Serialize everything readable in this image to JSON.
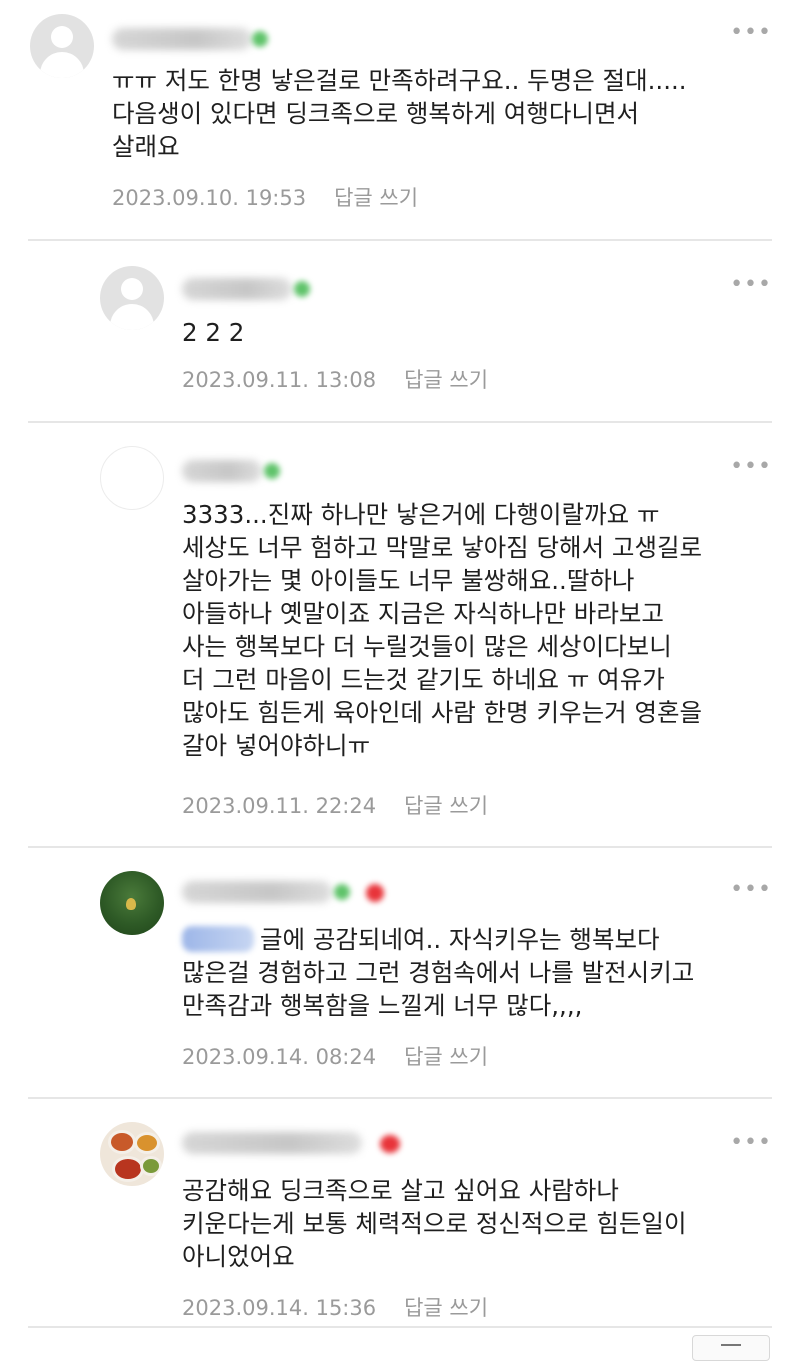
{
  "comments": [
    {
      "text": "ㅠㅠ 저도 한명 낳은걸로 만족하려구요.. 두명은 절대.....\n다음생이 있다면 딩크족으로 행복하게 여행다니면서\n살래요",
      "date": "2023.09.10. 19:53",
      "reply_label": "답글 쓰기"
    },
    {
      "text": "2 2 2",
      "date": "2023.09.11. 13:08",
      "reply_label": "답글 쓰기"
    },
    {
      "text": "3333...진짜 하나만 낳은거에 다행이랄까요 ㅠ\n세상도 너무 험하고 막말로 낳아짐 당해서 고생길로\n살아가는 몇 아이들도 너무 불쌍해요..딸하나\n아들하나 옛말이죠 지금은 자식하나만 바라보고\n사는 행복보다 더 누릴것들이 많은 세상이다보니\n더 그런 마음이 드는것 같기도 하네요 ㅠ 여유가\n많아도 힘든게 육아인데 사람 한명 키우는거 영혼을\n갈아 넣어야하니ㅠ",
      "date": "2023.09.11. 22:24",
      "reply_label": "답글 쓰기"
    },
    {
      "text_first": "글에 공감되네여.. 자식키우는 행복보다",
      "text_rest": "많은걸 경험하고 그런 경험속에서 나를 발전시키고\n만족감과 행복함을 느낄게 너무 많다,,,,",
      "date": "2023.09.14. 08:24",
      "reply_label": "답글 쓰기"
    },
    {
      "text": "공감해요 딩크족으로 살고 싶어요 사람하나\n키운다는게 보통 체력적으로 정신적으로 힘든일이\n아니었어요",
      "date": "2023.09.14. 15:36",
      "reply_label": "답글 쓰기"
    }
  ],
  "icons": {
    "more": "more-options-icon",
    "default_avatar": "default-profile-icon"
  },
  "colors": {
    "text": "#1f1f1f",
    "meta": "#9a9a9a",
    "divider": "#e6e6e6",
    "badge_green": "#5fc36a",
    "badge_red": "#e8343a"
  }
}
